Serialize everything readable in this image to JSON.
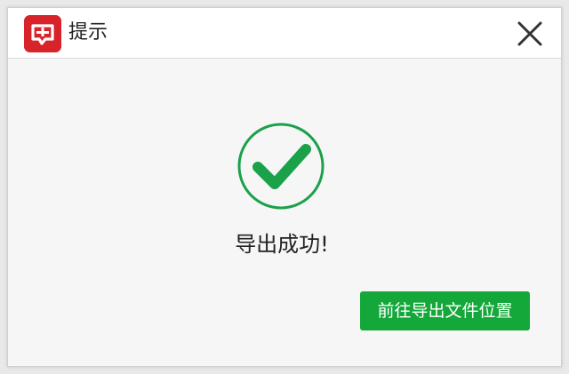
{
  "window": {
    "title": "提示",
    "app_icon": "red-chat-app-icon",
    "close_icon": "close-icon"
  },
  "dialog": {
    "status_icon": "check-circle-icon",
    "message": "导出成功!",
    "action_label": "前往导出文件位置"
  },
  "colors": {
    "accent_green": "#14a83b",
    "check_circle_green": "#1aa14a",
    "app_icon_red": "#d8232a",
    "dialog_background": "#f6f6f6",
    "titlebar_background": "#ffffff"
  }
}
